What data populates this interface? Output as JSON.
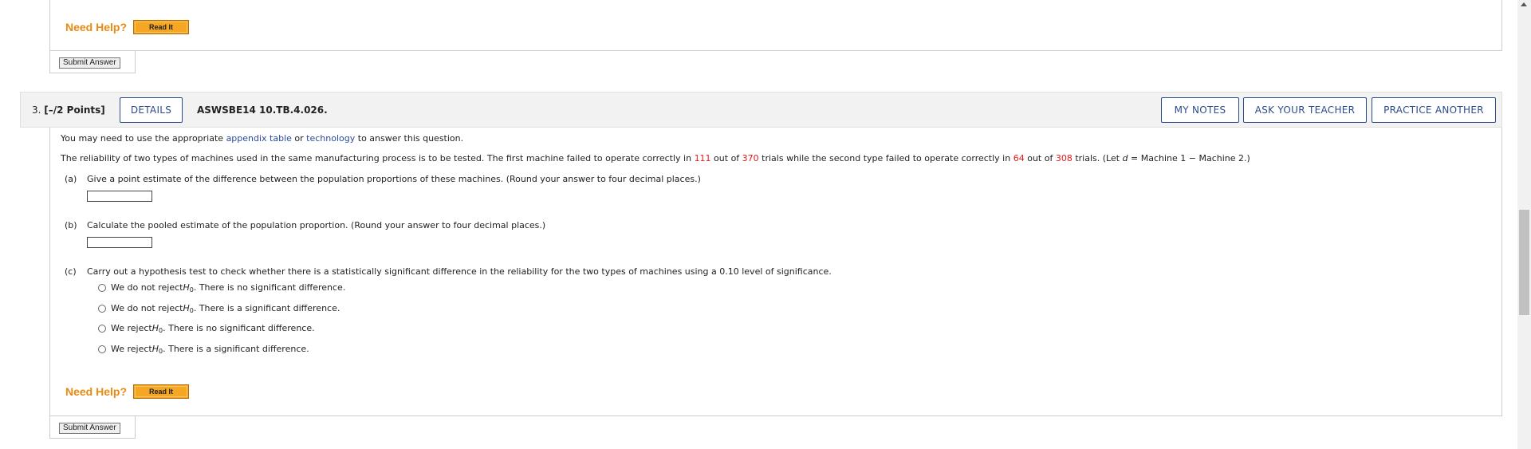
{
  "prev": {
    "need_help": "Need Help?",
    "read_it": "Read It",
    "submit": "Submit Answer"
  },
  "question": {
    "number": "3.",
    "points": "[–/2 Points]",
    "details_button": "DETAILS",
    "code": "ASWSBE14 10.TB.4.026.",
    "my_notes": "MY NOTES",
    "ask_teacher": "ASK YOUR TEACHER",
    "practice": "PRACTICE ANOTHER"
  },
  "body": {
    "intro_prefix": "You may need to use the appropriate ",
    "appendix_link": "appendix table",
    "intro_or": " or ",
    "technology_link": "technology",
    "intro_suffix": " to answer this question.",
    "problem_prefix": "The reliability of two types of machines used in the same manufacturing process is to be tested. The first machine failed to operate correctly in ",
    "n1_fail": "111",
    "out_of_1": " out of ",
    "n1": "370",
    "problem_mid": " trials while the second type failed to operate correctly in ",
    "n2_fail": "64",
    "out_of_2": " out of ",
    "n2": "308",
    "problem_suffix_pre": " trials. (Let ",
    "d_var": "d",
    "problem_suffix_post": " = Machine 1 − Machine 2.)",
    "part_a_label": "(a)",
    "part_a_text": "Give a point estimate of the difference between the population proportions of these machines. (Round your answer to four decimal places.)",
    "part_a_value": "",
    "part_b_label": "(b)",
    "part_b_text": "Calculate the pooled estimate of the population proportion. (Round your answer to four decimal places.)",
    "part_b_value": "",
    "part_c_label": "(c)",
    "part_c_text": "Carry out a hypothesis test to check whether there is a statistically significant difference in the reliability for the two types of machines using a 0.10 level of significance.",
    "options": [
      {
        "pre": "We do not reject ",
        "h": "H",
        "sub": "0",
        "post": ". There is no significant difference."
      },
      {
        "pre": "We do not reject ",
        "h": "H",
        "sub": "0",
        "post": ". There is a significant difference."
      },
      {
        "pre": "We reject ",
        "h": "H",
        "sub": "0",
        "post": ". There is no significant difference."
      },
      {
        "pre": "We reject ",
        "h": "H",
        "sub": "0",
        "post": ". There is a significant difference."
      }
    ],
    "need_help": "Need Help?",
    "read_it": "Read It",
    "submit": "Submit Answer"
  },
  "colors": {
    "help_orange": "#e98a12",
    "link_blue": "#2a4ba0",
    "value_red": "#e21b1b",
    "button_border": "#2b4c8c"
  }
}
